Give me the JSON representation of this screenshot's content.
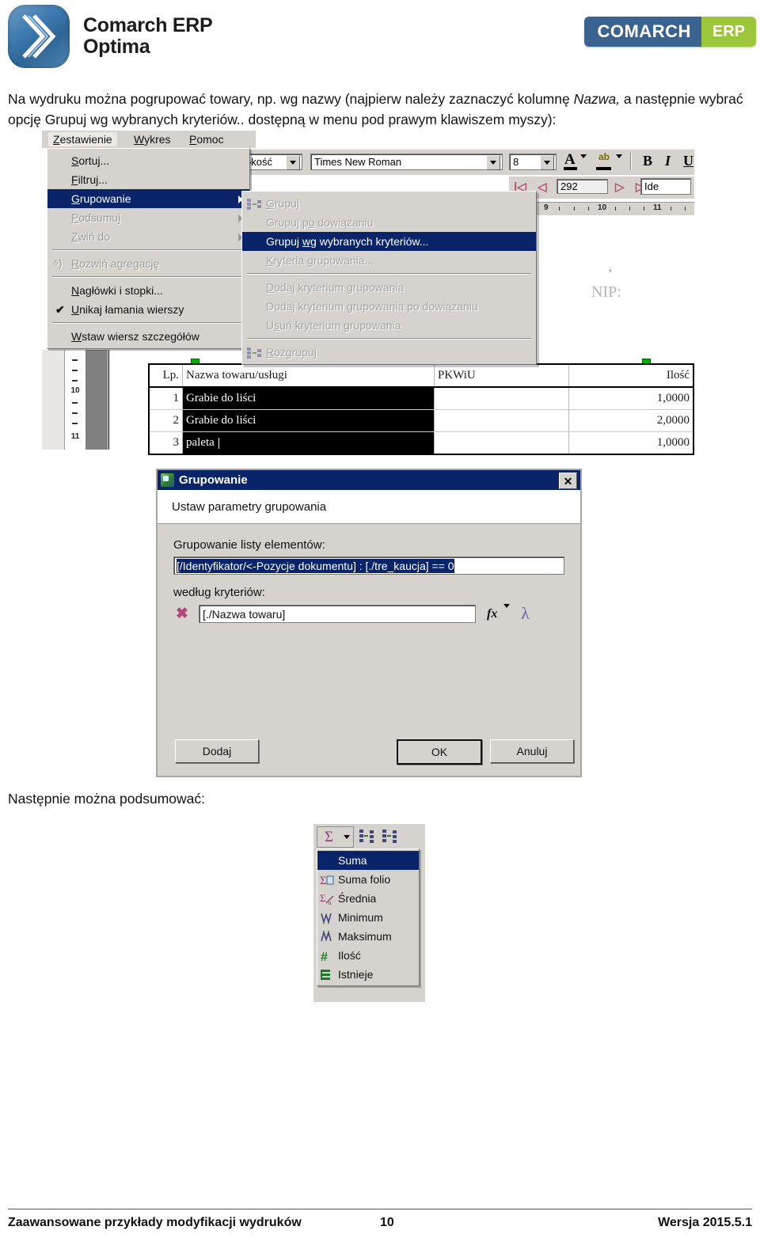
{
  "header": {
    "product_name_line1": "Comarch ERP",
    "product_name_line2": "Optima",
    "badge_left": "COMARCH",
    "badge_right": "ERP",
    "logo_icon": "comarch-chevron-logo"
  },
  "paragraphs": {
    "intro_part1": "Na wydruku można pogrupować towary, np. wg nazwy (najpierw należy zaznaczyć kolumnę ",
    "intro_italic": "Nazwa,",
    "intro_part2": " a następnie wybrać opcję Grupuj wg wybranych kryteriów.. dostępną w menu pod prawym klawiszem myszy):",
    "next_text": "Następnie można podsumować:"
  },
  "screenshot_menu": {
    "menubar": [
      {
        "label": "Zestawienie",
        "accel": "Z",
        "active": true
      },
      {
        "label": "Wykres",
        "accel": "W",
        "active": false
      },
      {
        "label": "Pomoc",
        "accel": "P",
        "active": false
      }
    ],
    "main_menu": [
      {
        "label": "Sortuj...",
        "accel": "S",
        "state": "normal",
        "submenu": false
      },
      {
        "label": "Filtruj...",
        "accel": "F",
        "state": "normal",
        "submenu": false
      },
      {
        "label": "Grupowanie",
        "accel": "G",
        "state": "selected",
        "submenu": true
      },
      {
        "label": "Podsumuj",
        "accel": "P",
        "state": "disabled",
        "submenu": true
      },
      {
        "label": "Zwiń do",
        "accel": "Z",
        "state": "disabled",
        "submenu": true
      },
      {
        "label": "Rozwiń agregację",
        "accel": "R",
        "state": "disabled",
        "submenu": false
      },
      {
        "label": "Nagłówki i stopki...",
        "accel": "N",
        "state": "normal",
        "submenu": false
      },
      {
        "label": "Unikaj łamania wierszy",
        "accel": "U",
        "state": "normal",
        "submenu": false,
        "checked": true
      },
      {
        "label": "Wstaw wiersz szczegółów",
        "accel": "W",
        "state": "normal",
        "submenu": false
      }
    ],
    "submenu": [
      {
        "label": "Grupuj",
        "accel": "G",
        "state": "disabled",
        "icon": "group-icon"
      },
      {
        "label": "Grupuj po dowiązaniu",
        "accel": "o",
        "state": "disabled",
        "icon": ""
      },
      {
        "label": "Grupuj wg wybranych kryteriów...",
        "accel": "wg",
        "state": "selected",
        "icon": ""
      },
      {
        "label": "Kryteria grupowania...",
        "accel": "K",
        "state": "disabled",
        "icon": ""
      },
      {
        "label": "Dodaj kryterium grupowania",
        "accel": "D",
        "state": "disabled",
        "icon": ""
      },
      {
        "label": "Dodaj kryterium grupowania po dowiązaniu",
        "accel": "j",
        "state": "disabled",
        "icon": ""
      },
      {
        "label": "Usuń kryterium grupowania",
        "accel": "s",
        "state": "disabled",
        "icon": ""
      },
      {
        "label": "Rozgrupuj",
        "accel": "R",
        "state": "disabled",
        "icon": "ungroup-icon"
      }
    ],
    "toolbar": {
      "width_combo_value": "okość",
      "font_combo_value": "Times New Roman",
      "size_combo_value": "8",
      "font_color_label": "A",
      "highlight_label": "ab",
      "bold_label": "B",
      "italic_label": "I",
      "underline_label": "U"
    },
    "navbar": {
      "record_value": "292",
      "id_field_value": "Ide",
      "first_icon": "first-record-icon",
      "prev_icon": "prev-record-icon",
      "next_icon": "next-record-icon",
      "last_icon": "last-record-icon"
    },
    "ruler_h_labels": [
      "9",
      "10",
      "11"
    ],
    "ruler_v_labels": [
      "10",
      "11"
    ],
    "watermark_text": "NIP:",
    "watermark_comma": ","
  },
  "grid": {
    "columns": [
      "Lp.",
      "Nazwa towaru/usługi",
      "PKWiU",
      "Ilość"
    ],
    "rows": [
      {
        "lp": "1",
        "nazwa": "Grabie do liści",
        "pkwiu": "",
        "ilosc": "1,0000",
        "selected": true
      },
      {
        "lp": "2",
        "nazwa": "Grabie do liści",
        "pkwiu": "",
        "ilosc": "2,0000",
        "selected": true
      },
      {
        "lp": "3",
        "nazwa": "paleta",
        "pkwiu": "",
        "ilosc": "1,0000",
        "selected": true
      }
    ]
  },
  "dialog": {
    "title": "Grupowanie",
    "icon": "grouping-window-icon",
    "close_label": "✕",
    "banner": "Ustaw parametry grupowania",
    "list_label": "Grupowanie listy elementów:",
    "list_value": "[/Identyfikator/<-Pozycje dokumentu] : [./tre_kaucja] == 0",
    "criteria_label": "według kryteriów:",
    "criteria_value": "[./Nazwa towaru]",
    "remove_icon": "delete-criterion-icon",
    "fx_label": "fx",
    "lambda_label": "λ",
    "buttons": {
      "add": "Dodaj",
      "ok": "OK",
      "cancel": "Anuluj"
    }
  },
  "summary_menu": {
    "sigma_label": "Σ",
    "sigma_icon": "sum-icon",
    "dropdown_icon": "chevron-down-icon",
    "group_icon_1": "group-rows-icon",
    "group_icon_2": "ungroup-rows-icon",
    "items": [
      {
        "label": "Suma",
        "icon": "sum-icon",
        "selected": true
      },
      {
        "label": "Suma folio",
        "icon": "sum-folio-icon",
        "selected": false
      },
      {
        "label": "Średnia",
        "icon": "average-icon",
        "selected": false
      },
      {
        "label": "Minimum",
        "icon": "minimum-icon",
        "selected": false
      },
      {
        "label": "Maksimum",
        "icon": "maximum-icon",
        "selected": false
      },
      {
        "label": "Ilość",
        "icon": "count-icon",
        "selected": false
      },
      {
        "label": "Istnieje",
        "icon": "exists-icon",
        "selected": false
      }
    ]
  },
  "footer": {
    "left": "Zaawansowane przykłady modyfikacji wydruków",
    "page": "10",
    "right": "Wersja 2015.5.1"
  },
  "colors": {
    "brand_blue": "#3b6391",
    "brand_green": "#9ec63b",
    "menu_highlight": "#0a246a",
    "window_face": "#d6d3ce"
  }
}
